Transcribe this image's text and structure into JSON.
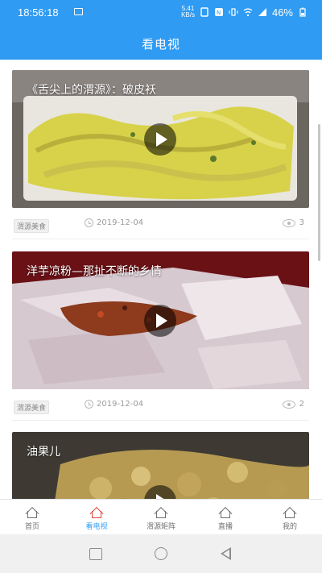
{
  "status": {
    "time": "18:56:18",
    "speed": "5.41\nKB/s",
    "battery": "46%"
  },
  "header": {
    "title": "看电视"
  },
  "feed": {
    "items": [
      {
        "caption": "《舌尖上的渭源》：破皮袄",
        "tag": "渭源美食",
        "date": "2019-12-04",
        "views": "3"
      },
      {
        "caption": "洋芋凉粉—那扯不断的乡情",
        "tag": "渭源美食",
        "date": "2019-12-04",
        "views": "2"
      },
      {
        "caption": "油果儿"
      }
    ]
  },
  "bottom_nav": {
    "items": [
      {
        "label": "首页"
      },
      {
        "label": "看电视"
      },
      {
        "label": "渭源矩阵"
      },
      {
        "label": "直播"
      },
      {
        "label": "我的"
      }
    ],
    "active_color": "#2f9bf2",
    "active_icon_color": "#e0463b"
  },
  "colors": {
    "brand": "#2f9bf2"
  }
}
